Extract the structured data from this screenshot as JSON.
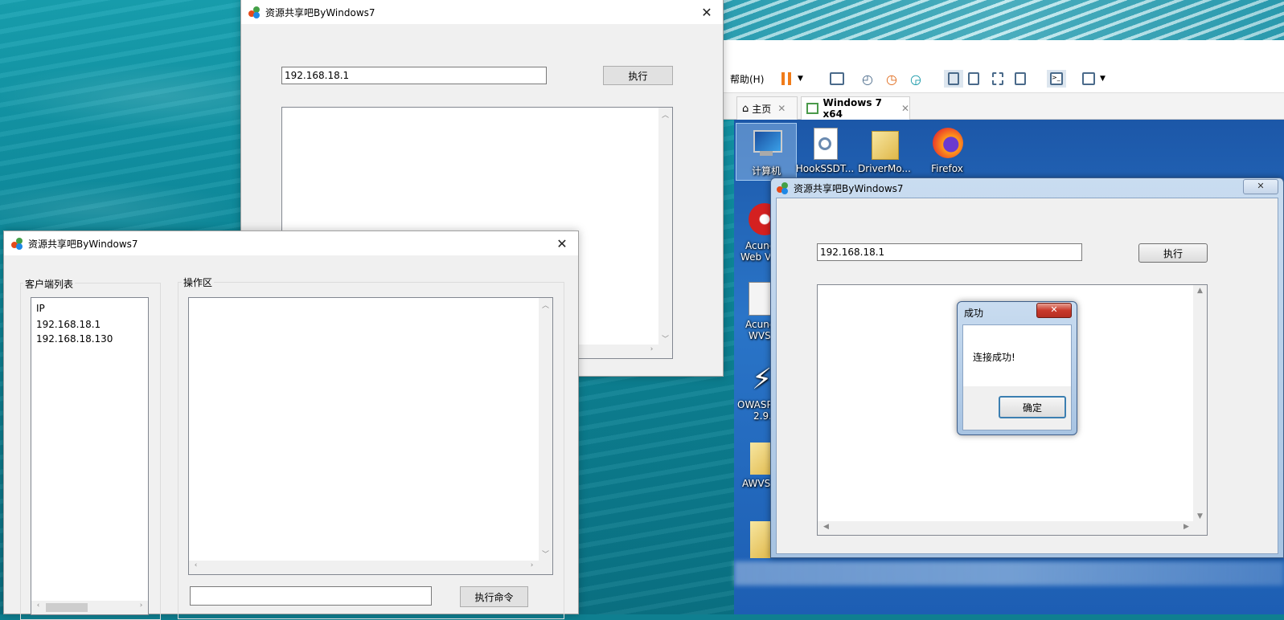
{
  "app_title": "资源共享吧ByWindows7",
  "server_window": {
    "ip_value": "192.168.18.1",
    "execute_label": "执行"
  },
  "client_window": {
    "client_group_label": "客户端列表",
    "op_group_label": "操作区",
    "client_header": "IP",
    "clients": [
      "192.168.18.1",
      "192.168.18.130"
    ],
    "command_input_value": "",
    "run_command_label": "执行命令"
  },
  "vmware": {
    "menu_help": "帮助(H)",
    "tabs": [
      {
        "label": "主页",
        "icon": "home-icon"
      },
      {
        "label": "Windows 7 x64",
        "icon": "vm-icon"
      }
    ]
  },
  "guest": {
    "desktop_icons": [
      {
        "label": "计算机",
        "icon": "computer-icon"
      },
      {
        "label": "HookSSDT...",
        "icon": "settings-file-icon"
      },
      {
        "label": "DriverMo...",
        "icon": "folder-icon"
      },
      {
        "label": "Firefox",
        "icon": "firefox-icon"
      }
    ],
    "left_icons": [
      "Acune",
      "Web V",
      "Acune",
      "WVS",
      "OWASP",
      "2.9.",
      "AWVS"
    ],
    "app_window": {
      "title": "资源共享吧ByWindows7",
      "ip_value": "192.168.18.1",
      "execute_label": "执行"
    },
    "dialog": {
      "title": "成功",
      "message": "连接成功!",
      "ok_label": "确定"
    }
  }
}
